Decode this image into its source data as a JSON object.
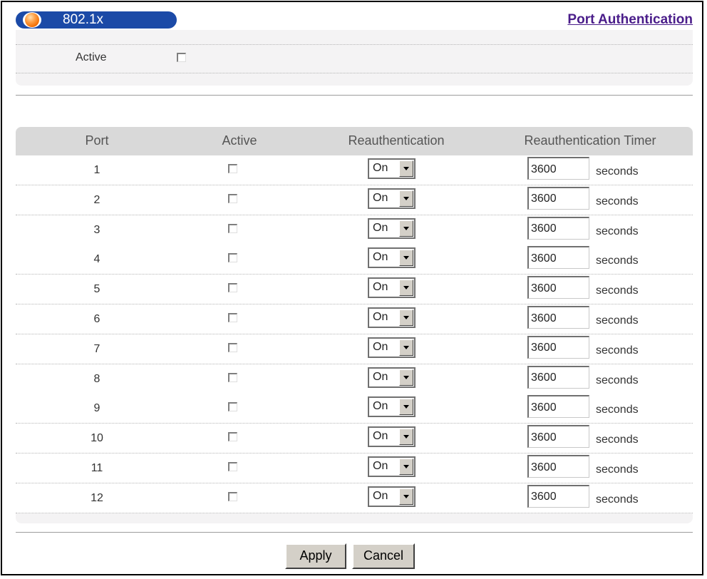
{
  "header": {
    "title": "802.1x",
    "link": "Port Authentication"
  },
  "global": {
    "active_label": "Active",
    "active_checked": false
  },
  "table": {
    "headers": {
      "port": "Port",
      "active": "Active",
      "reauth": "Reauthentication",
      "timer": "Reauthentication Timer"
    },
    "unit": "seconds",
    "rows": [
      {
        "port": "1",
        "active": false,
        "reauth": "On",
        "timer": "3600"
      },
      {
        "port": "2",
        "active": false,
        "reauth": "On",
        "timer": "3600"
      },
      {
        "port": "3",
        "active": false,
        "reauth": "On",
        "timer": "3600"
      },
      {
        "port": "4",
        "active": false,
        "reauth": "On",
        "timer": "3600"
      },
      {
        "port": "5",
        "active": false,
        "reauth": "On",
        "timer": "3600"
      },
      {
        "port": "6",
        "active": false,
        "reauth": "On",
        "timer": "3600"
      },
      {
        "port": "7",
        "active": false,
        "reauth": "On",
        "timer": "3600"
      },
      {
        "port": "8",
        "active": false,
        "reauth": "On",
        "timer": "3600"
      },
      {
        "port": "9",
        "active": false,
        "reauth": "On",
        "timer": "3600"
      },
      {
        "port": "10",
        "active": false,
        "reauth": "On",
        "timer": "3600"
      },
      {
        "port": "11",
        "active": false,
        "reauth": "On",
        "timer": "3600"
      },
      {
        "port": "12",
        "active": false,
        "reauth": "On",
        "timer": "3600"
      }
    ]
  },
  "buttons": {
    "apply": "Apply",
    "cancel": "Cancel"
  }
}
